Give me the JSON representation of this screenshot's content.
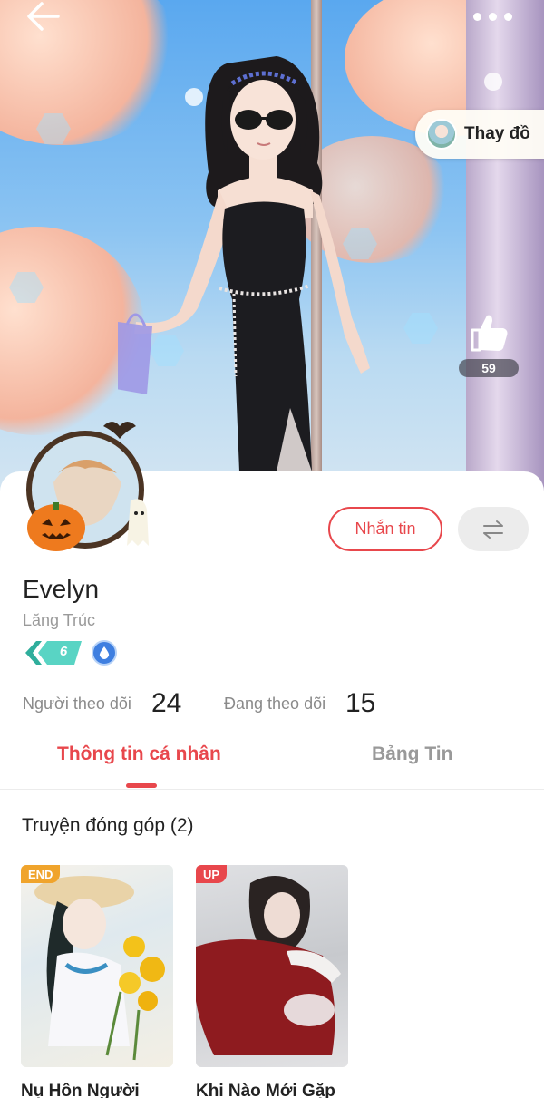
{
  "header": {
    "back_icon": "arrow-left-icon",
    "more_icon": "more-horizontal-icon"
  },
  "outfit": {
    "label": "Thay đồ"
  },
  "like": {
    "icon": "thumbs-up-icon",
    "count": "59"
  },
  "profile": {
    "name": "Evelyn",
    "sub_name": "Lăng Trúc",
    "level": "6",
    "message_button": "Nhắn tin",
    "swap_icon": "swap-arrows-icon"
  },
  "stats": {
    "followers_label": "Người theo dõi",
    "followers_count": "24",
    "following_label": "Đang theo dõi",
    "following_count": "15"
  },
  "tabs": [
    {
      "label": "Thông tin cá nhân",
      "active": true
    },
    {
      "label": "Bảng Tin",
      "active": false
    }
  ],
  "contributions": {
    "title": "Truyện đóng góp (2)",
    "books": [
      {
        "tag": "END",
        "title": "Nụ Hôn Người"
      },
      {
        "tag": "UP",
        "title": "Khi Nào Mới Gặp"
      }
    ]
  },
  "colors": {
    "accent": "#e8474c",
    "tag_end": "#f0a42c",
    "tag_up": "#e8474c",
    "level_badge": "#4fc7b8",
    "vip_badge": "#3f7fe0"
  }
}
